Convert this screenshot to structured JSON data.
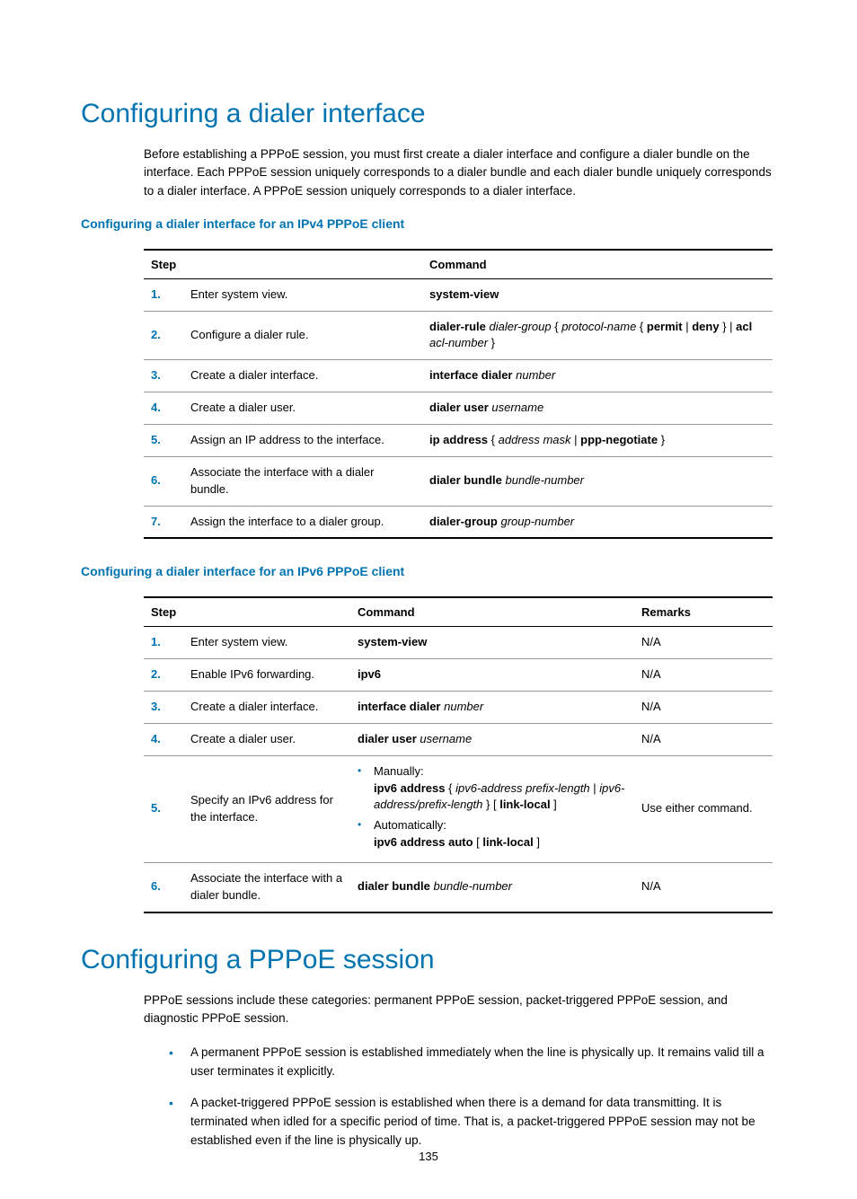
{
  "heading1": "Configuring a dialer interface",
  "intro1": "Before establishing a PPPoE session, you must first create a dialer interface and configure a dialer bundle on the interface. Each PPPoE session uniquely corresponds to a dialer bundle and each dialer bundle uniquely corresponds to a dialer interface. A PPPoE session uniquely corresponds to a dialer interface.",
  "sub1": "Configuring a dialer interface for an IPv4 PPPoE client",
  "t1": {
    "h1": "Step",
    "h2": "Command",
    "rows": [
      {
        "n": "1.",
        "step": "Enter system view.",
        "cmd_html": "<span class='b'>system-view</span>"
      },
      {
        "n": "2.",
        "step": "Configure a dialer rule.",
        "cmd_html": "<span class='b'>dialer-rule</span> <span class='i'>dialer-group</span> { <span class='i'>protocol-name</span> { <span class='b'>permit</span> | <span class='b'>deny</span> } | <span class='b'>acl</span> <span class='i'>acl-number</span> }"
      },
      {
        "n": "3.",
        "step": "Create a dialer interface.",
        "cmd_html": "<span class='b'>interface dialer</span> <span class='i'>number</span>"
      },
      {
        "n": "4.",
        "step": "Create a dialer user.",
        "cmd_html": "<span class='b'>dialer user</span> <span class='i'>username</span>"
      },
      {
        "n": "5.",
        "step": "Assign an IP address to the interface.",
        "cmd_html": "<span class='b'>ip address</span> { <span class='i'>address mask</span> | <span class='b'>ppp-negotiate</span> }"
      },
      {
        "n": "6.",
        "step": "Associate the interface with a dialer bundle.",
        "cmd_html": "<span class='b'>dialer bundle</span> <span class='i'>bundle-number</span>"
      },
      {
        "n": "7.",
        "step": "Assign the interface to a dialer group.",
        "cmd_html": "<span class='b'>dialer-group</span> <span class='i'>group-number</span>"
      }
    ]
  },
  "sub2": "Configuring a dialer interface for an IPv6 PPPoE client",
  "t2": {
    "h1": "Step",
    "h2": "Command",
    "h3": "Remarks",
    "rows": [
      {
        "n": "1.",
        "step": "Enter system view.",
        "cmd_html": "<span class='b'>system-view</span>",
        "rem": "N/A"
      },
      {
        "n": "2.",
        "step": "Enable IPv6 forwarding.",
        "cmd_html": "<span class='b'>ipv6</span>",
        "rem": "N/A"
      },
      {
        "n": "3.",
        "step": "Create a dialer interface.",
        "cmd_html": "<span class='b'>interface dialer</span> <span class='i'>number</span>",
        "rem": "N/A"
      },
      {
        "n": "4.",
        "step": "Create a dialer user.",
        "cmd_html": "<span class='b'>dialer user</span> <span class='i'>username</span>",
        "rem": "N/A"
      },
      {
        "n": "5.",
        "step": "Specify an IPv6 address for the interface.",
        "cmd_html": "<ul class='inner-list'><li>Manually:<br><span class='b'>ipv6 address</span> { <span class='i'>ipv6-address prefix-length</span> | <span class='i'>ipv6-address/prefix-length</span> } [ <span class='b'>link-local</span> ]</li><li>Automatically:<br><span class='b'>ipv6 address auto</span> [ <span class='b'>link-local</span> ]</li></ul>",
        "rem": "Use either command."
      },
      {
        "n": "6.",
        "step": "Associate the interface with a dialer bundle.",
        "cmd_html": "<span class='b'>dialer bundle</span> <span class='i'>bundle-number</span>",
        "rem": "N/A"
      }
    ]
  },
  "heading2": "Configuring a PPPoE session",
  "intro2": "PPPoE sessions include these categories: permanent PPPoE session, packet-triggered PPPoE session, and diagnostic PPPoE session.",
  "bullets": [
    "A permanent PPPoE session is established immediately when the line is physically up. It remains valid till a user terminates it explicitly.",
    "A packet-triggered PPPoE session is established when there is a demand for data transmitting. It is terminated when idled for a specific period of time. That is, a packet-triggered PPPoE session may not be established even if the line is physically up."
  ],
  "page_number": "135"
}
